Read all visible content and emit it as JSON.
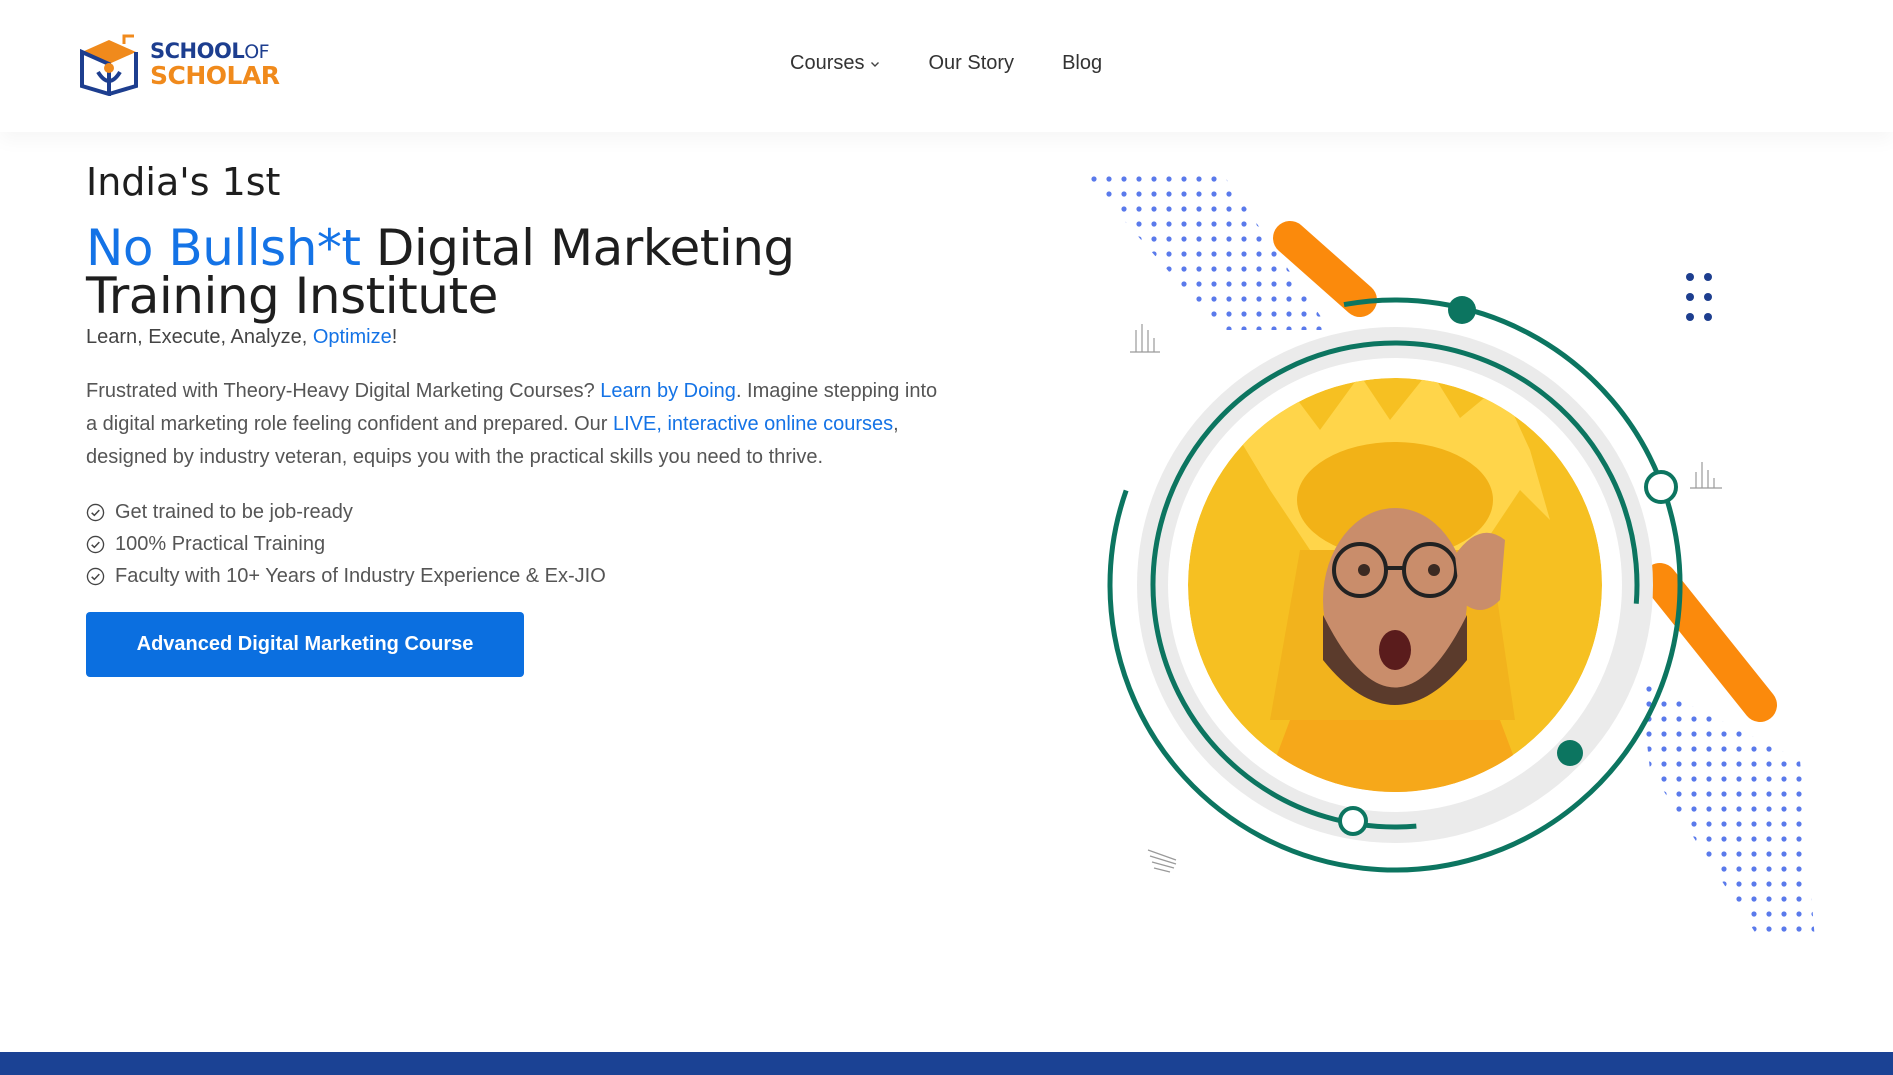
{
  "brand": {
    "line1": "SCHOOL",
    "line1_suffix": "OF",
    "line2": "SCHOLAR",
    "colors": {
      "navy": "#1d3e8f",
      "orange": "#f08a1c"
    }
  },
  "nav": {
    "items": [
      {
        "label": "Courses",
        "has_dropdown": true
      },
      {
        "label": "Our Story",
        "has_dropdown": false
      },
      {
        "label": "Blog",
        "has_dropdown": false
      }
    ]
  },
  "hero": {
    "kicker": "India's 1st",
    "headline_accent": "No Bullsh*t",
    "headline_rest": " Digital Marketing",
    "headline_line2": "Training Institute",
    "tagline_start": "Learn, Execute, Analyze, ",
    "tagline_accent": "Optimize",
    "tagline_end": "!",
    "desc_1": "Frustrated with Theory-Heavy Digital Marketing Courses? ",
    "desc_link_1": "Learn by Doing",
    "desc_2": ". Imagine stepping into a digital marketing role feeling confident and prepared. Our ",
    "desc_link_2": "LIVE, interactive online courses",
    "desc_3": ", designed by industry veteran, equips you with the practical skills you need to thrive.",
    "bullets": [
      "Get trained to be job-ready",
      "100% Practical Training",
      "Faculty with 10+ Years of Industry Experience & Ex-JIO"
    ],
    "cta_label": "Advanced Digital Marketing Course"
  },
  "colors": {
    "accent_blue": "#1473e6",
    "button_blue": "#0b6fe0",
    "ring_green": "#0c7560",
    "stripe_orange": "#fb8a0c",
    "dot_blue": "#3d63e8",
    "portrait_yellow": "#f6c022",
    "footer_navy": "#1b4294"
  }
}
